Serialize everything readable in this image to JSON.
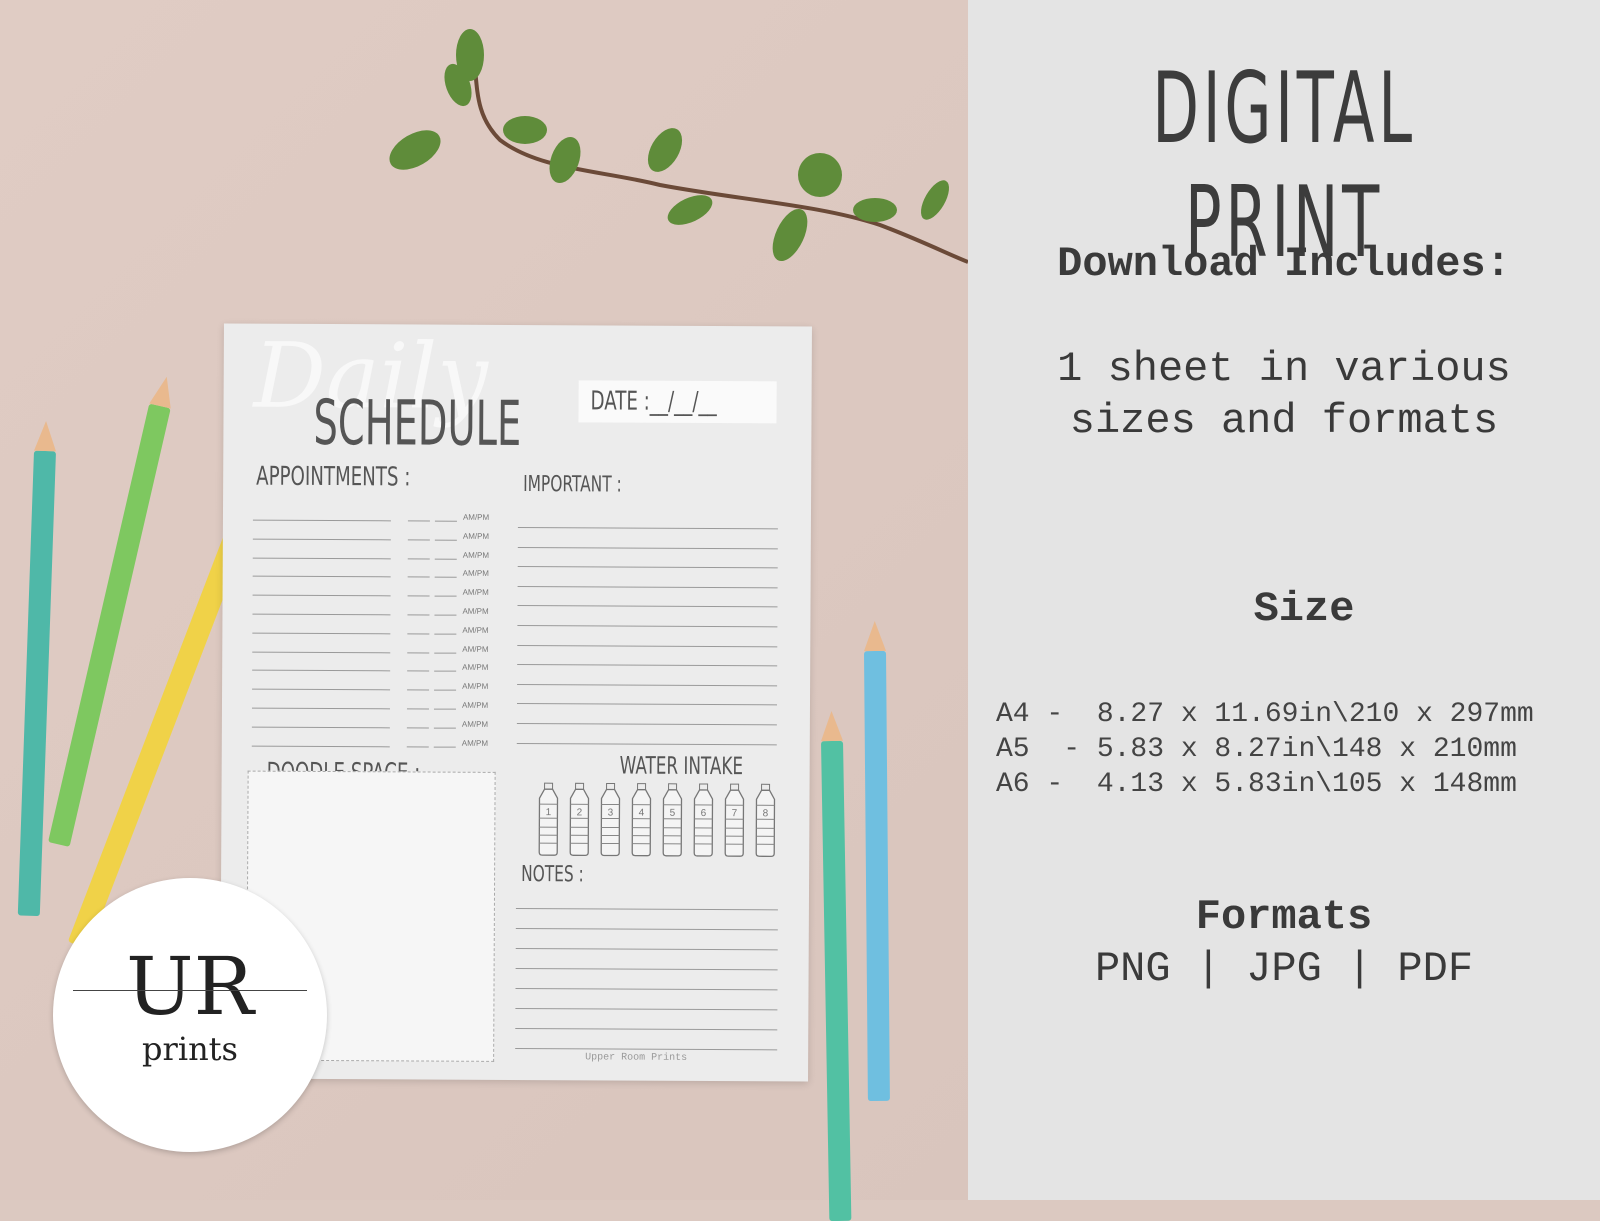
{
  "panel": {
    "title": "DIGITAL PRINT",
    "download_heading": "Download Includes:",
    "download_text_1": "1 sheet in various",
    "download_text_2": "sizes and formats",
    "size_heading": "Size",
    "sizes": [
      "A4 -  8.27 x 11.69in\\210 x 297mm",
      "A5  - 5.83 x 8.27in\\148 x 210mm",
      "A6 -  4.13 x 5.83in\\105 x 148mm"
    ],
    "formats_heading": "Formats",
    "formats": "PNG | JPG | PDF"
  },
  "sheet": {
    "script_title": "Daily",
    "title": "SCHEDULE",
    "date_label": "DATE :__/__/__",
    "appointments_label": "APPOINTMENTS :",
    "important_label": "IMPORTANT :",
    "doodle_label": "DOODLE SPACE :",
    "water_label": "WATER INTAKE",
    "notes_label": "NOTES :",
    "ampm": "AM/PM",
    "footer": "Upper Room Prints",
    "bottles": [
      "1",
      "2",
      "3",
      "4",
      "5",
      "6",
      "7",
      "8"
    ]
  },
  "logo": {
    "text": "UR",
    "sub": "prints"
  },
  "colors": {
    "background": "#dcc9c1",
    "panel": "#e4e4e4",
    "text": "#3a3a3a",
    "paper": "#ececec"
  }
}
